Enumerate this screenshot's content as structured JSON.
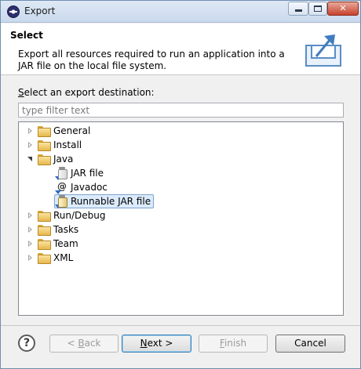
{
  "window": {
    "title": "Export"
  },
  "header": {
    "title": "Select",
    "description": "Export all resources required to run an application into a JAR file on the local file system."
  },
  "body": {
    "dest_label_prefix": "",
    "dest_label_mnemonic": "S",
    "dest_label_rest": "elect an export destination:",
    "filter_placeholder": "type filter text",
    "filter_value": ""
  },
  "tree": {
    "items": [
      {
        "label": "General",
        "icon": "folder-icon",
        "expanded": false,
        "depth": 0
      },
      {
        "label": "Install",
        "icon": "folder-icon",
        "expanded": false,
        "depth": 0
      },
      {
        "label": "Java",
        "icon": "folder-icon",
        "expanded": true,
        "depth": 0
      },
      {
        "label": "JAR file",
        "icon": "jar-file-icon",
        "depth": 1
      },
      {
        "label": "Javadoc",
        "icon": "javadoc-icon",
        "depth": 1
      },
      {
        "label": "Runnable JAR file",
        "icon": "runnable-jar-icon",
        "depth": 1,
        "selected": true
      },
      {
        "label": "Run/Debug",
        "icon": "folder-icon",
        "expanded": false,
        "depth": 0
      },
      {
        "label": "Tasks",
        "icon": "folder-icon",
        "expanded": false,
        "depth": 0
      },
      {
        "label": "Team",
        "icon": "folder-icon",
        "expanded": false,
        "depth": 0
      },
      {
        "label": "XML",
        "icon": "folder-icon",
        "expanded": false,
        "depth": 0
      }
    ]
  },
  "buttons": {
    "help": "?",
    "back_prefix": "< ",
    "back_mnemonic": "B",
    "back_rest": "ack",
    "next_prefix": "",
    "next_mnemonic": "N",
    "next_rest": "ext >",
    "finish_prefix": "",
    "finish_mnemonic": "F",
    "finish_rest": "inish",
    "cancel": "Cancel"
  },
  "colors": {
    "selection_bg": "#dcebfc",
    "selection_border": "#7da2ce",
    "folder": "#e7b84c"
  }
}
